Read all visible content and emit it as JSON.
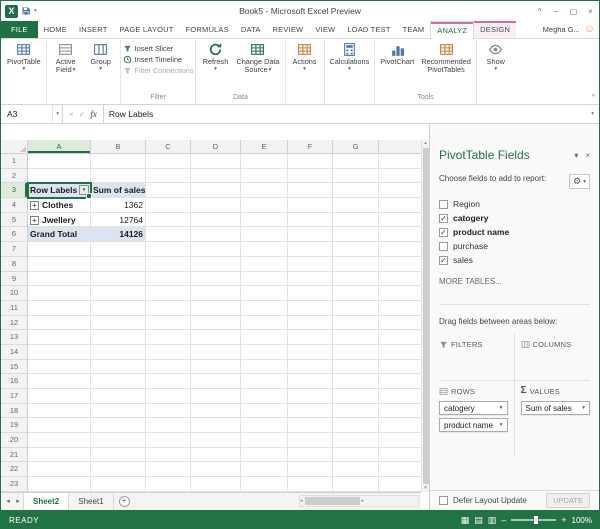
{
  "icons": {
    "excel_logo": "X",
    "dropdown": "▾",
    "up": "▴",
    "left": "◂",
    "right": "▸",
    "minimize": "–",
    "maximize": "▢",
    "close": "×",
    "ribbon_options": "^",
    "check": "✓",
    "cancel": "×",
    "fx": "fx",
    "smiley": "☺",
    "gear": "⚙",
    "plus": "+",
    "minus": "–",
    "sigma": "Σ",
    "collapse_ribbon": "^",
    "view_normal": "▦",
    "view_layout": "▤",
    "view_break": "▥"
  },
  "titlebar": {
    "title": "Book5 - Microsoft Excel Preview"
  },
  "ribbon": {
    "file_tab": "FILE",
    "tabs": [
      "HOME",
      "INSERT",
      "PAGE LAYOUT",
      "FORMULAS",
      "DATA",
      "REVIEW",
      "VIEW",
      "LOAD TEST",
      "TEAM",
      "ANALYZ",
      "DESIGN"
    ],
    "user": "Megha G...",
    "buttons": {
      "pivottable": {
        "line1": "PivotTable"
      },
      "active_field": {
        "line1": "Active",
        "line2": "Field"
      },
      "group": {
        "line1": "Group"
      },
      "insert_slicer": "Insert Slicer",
      "insert_timeline": "Insert Timeline",
      "filter_connections": "Filter Connections",
      "refresh": {
        "line1": "Refresh"
      },
      "change_data_source": {
        "line1": "Change Data",
        "line2": "Source"
      },
      "actions": {
        "line1": "Actions"
      },
      "calculations": {
        "line1": "Calculations"
      },
      "pivotchart": {
        "line1": "PivotChart"
      },
      "recommended": {
        "line1": "Recommended",
        "line2": "PivotTables"
      },
      "show": {
        "line1": "Show"
      }
    },
    "group_labels": {
      "filter": "Filter",
      "data": "Data",
      "tools": "Tools"
    }
  },
  "formula_bar": {
    "name_box": "A3",
    "value": "Row Labels"
  },
  "grid": {
    "columns": [
      "A",
      "B",
      "C",
      "D",
      "E",
      "F",
      "G"
    ],
    "row_numbers": [
      "1",
      "2",
      "3",
      "4",
      "5",
      "6",
      "7",
      "8",
      "9",
      "10",
      "11",
      "12",
      "13",
      "14",
      "15",
      "16",
      "17",
      "18",
      "19",
      "20",
      "21",
      "22",
      "23"
    ],
    "cells": {
      "a3": "Row Labels",
      "b3": "Sum of sales",
      "a4": "Clothes",
      "b4": "1362",
      "a5": "Jwellery",
      "b5": "12764",
      "a6": "Grand Total",
      "b6": "14126"
    }
  },
  "sheet_tabs": {
    "sheet2": "Sheet2",
    "sheet1": "Sheet1"
  },
  "status_bar": {
    "mode": "READY",
    "zoom": "100%"
  },
  "pane": {
    "title": "PivotTable Fields",
    "choose_label": "Choose fields to add to report:",
    "fields": [
      {
        "label": "Region",
        "mark": ""
      },
      {
        "label": "catogery",
        "mark": "✓"
      },
      {
        "label": "product name",
        "mark": "✓"
      },
      {
        "label": "purchase",
        "mark": ""
      },
      {
        "label": "sales",
        "mark": "✓"
      }
    ],
    "more_tables": "MORE TABLES...",
    "drag_label": "Drag fields between areas below:",
    "areas": {
      "filters": "FILTERS",
      "columns": "COLUMNS",
      "rows": "ROWS",
      "values": "VALUES"
    },
    "rows_items": [
      "catogery",
      "product name"
    ],
    "values_items": [
      "Sum of sales"
    ],
    "defer_label": "Defer Layout Update",
    "update_button": "UPDATE"
  }
}
